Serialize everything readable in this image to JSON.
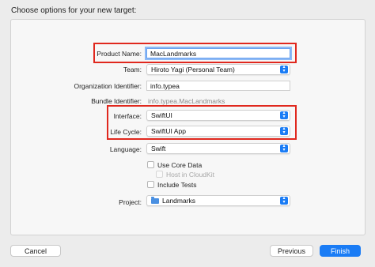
{
  "dialog": {
    "header": "Choose options for your new target:"
  },
  "form": {
    "product_name": {
      "label": "Product Name:",
      "value": "MacLandmarks"
    },
    "team": {
      "label": "Team:",
      "value": "Hiroto Yagi (Personal Team)"
    },
    "organization_identifier": {
      "label": "Organization Identifier:",
      "value": "info.typea"
    },
    "bundle_identifier": {
      "label": "Bundle Identifier:",
      "value": "info.typea.MacLandmarks"
    },
    "interface": {
      "label": "Interface:",
      "value": "SwiftUI"
    },
    "life_cycle": {
      "label": "Life Cycle:",
      "value": "SwiftUI App"
    },
    "language": {
      "label": "Language:",
      "value": "Swift"
    },
    "options": {
      "use_core_data": {
        "label": "Use Core Data",
        "checked": false,
        "enabled": true
      },
      "host_in_cloudkit": {
        "label": "Host in CloudKit",
        "checked": false,
        "enabled": false
      },
      "include_tests": {
        "label": "Include Tests",
        "checked": false,
        "enabled": true
      }
    },
    "project": {
      "label": "Project:",
      "value": "Landmarks"
    }
  },
  "buttons": {
    "cancel": "Cancel",
    "previous": "Previous",
    "finish": "Finish"
  },
  "colors": {
    "accent": "#1a7cf5",
    "highlight_box": "#e0281e"
  }
}
